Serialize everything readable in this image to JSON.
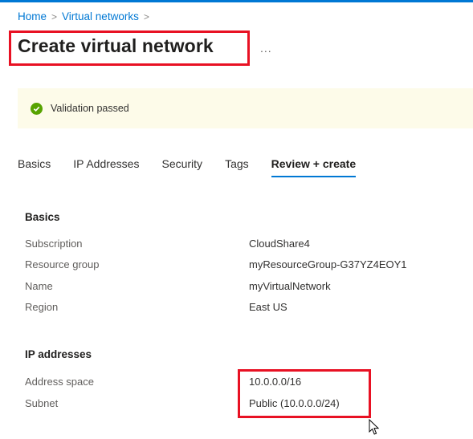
{
  "breadcrumb": {
    "home": "Home",
    "sep1": ">",
    "current": "Virtual networks",
    "sep2": ">"
  },
  "page": {
    "title": "Create virtual network",
    "more": "..."
  },
  "validation": {
    "text": "Validation passed",
    "icon": "check-circle-icon",
    "color": "#57a300"
  },
  "tabs": [
    {
      "label": "Basics"
    },
    {
      "label": "IP Addresses"
    },
    {
      "label": "Security"
    },
    {
      "label": "Tags"
    },
    {
      "label": "Review + create",
      "active": true
    }
  ],
  "basics": {
    "heading": "Basics",
    "rows": [
      {
        "key": "Subscription",
        "value": "CloudShare4"
      },
      {
        "key": "Resource group",
        "value": "myResourceGroup-G37YZ4EOY1"
      },
      {
        "key": "Name",
        "value": "myVirtualNetwork"
      },
      {
        "key": "Region",
        "value": "East US"
      }
    ]
  },
  "ip": {
    "heading": "IP addresses",
    "rows": [
      {
        "key": "Address space",
        "value": "10.0.0.0/16"
      },
      {
        "key": "Subnet",
        "value": "Public (10.0.0.0/24)"
      }
    ]
  },
  "colors": {
    "accent": "#0078d4",
    "highlight": "#e81123",
    "banner_bg": "#fdfbe9"
  }
}
